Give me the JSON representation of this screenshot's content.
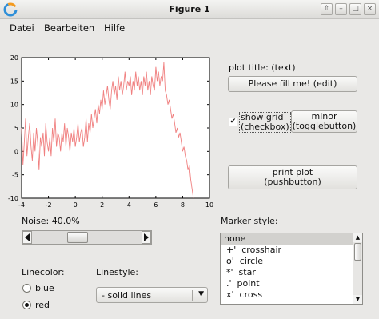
{
  "window": {
    "title": "Figure 1",
    "controls": [
      "restore-icon",
      "minimize-icon",
      "maximize-icon",
      "close-icon"
    ]
  },
  "menu": [
    {
      "label": "Datei"
    },
    {
      "label": "Bearbeiten"
    },
    {
      "label": "Hilfe"
    }
  ],
  "chart_data": {
    "type": "line",
    "color": "#f08080",
    "xlim": [
      -4,
      10
    ],
    "ylim": [
      -10,
      20
    ],
    "xticks": [
      "-4",
      "-2",
      "0",
      "2",
      "4",
      "6",
      "8",
      "10"
    ],
    "yticks": [
      "-10",
      "-5",
      "0",
      "5",
      "10",
      "15",
      "20"
    ],
    "grid": false,
    "x": [
      -4.0,
      -3.9,
      -3.8,
      -3.7,
      -3.6,
      -3.5,
      -3.4,
      -3.3,
      -3.2,
      -3.1,
      -3.0,
      -2.9,
      -2.8,
      -2.7,
      -2.6,
      -2.5,
      -2.4,
      -2.3,
      -2.2,
      -2.1,
      -2.0,
      -1.9,
      -1.8,
      -1.7,
      -1.6,
      -1.5,
      -1.4,
      -1.3,
      -1.2,
      -1.1,
      -1.0,
      -0.9,
      -0.8,
      -0.7,
      -0.6,
      -0.5,
      -0.4,
      -0.3,
      -0.2,
      -0.1,
      0.0,
      0.1,
      0.2,
      0.3,
      0.4,
      0.5,
      0.6,
      0.7,
      0.8,
      0.9,
      1.0,
      1.1,
      1.2,
      1.3,
      1.4,
      1.5,
      1.6,
      1.7,
      1.8,
      1.9,
      2.0,
      2.1,
      2.2,
      2.3,
      2.4,
      2.5,
      2.6,
      2.7,
      2.8,
      2.9,
      3.0,
      3.1,
      3.2,
      3.3,
      3.4,
      3.5,
      3.6,
      3.7,
      3.8,
      3.9,
      4.0,
      4.1,
      4.2,
      4.3,
      4.4,
      4.5,
      4.6,
      4.7,
      4.8,
      4.9,
      5.0,
      5.1,
      5.2,
      5.3,
      5.4,
      5.5,
      5.6,
      5.7,
      5.8,
      5.9,
      6.0,
      6.1,
      6.2,
      6.3,
      6.4,
      6.5,
      6.6,
      6.7,
      6.8,
      6.9,
      7.0,
      7.1,
      7.2,
      7.3,
      7.4,
      7.5,
      7.6,
      7.7,
      7.8,
      7.9,
      8.0,
      8.1,
      8.2,
      8.3,
      8.4,
      8.5,
      8.6,
      8.7,
      8.8,
      8.9,
      9.0
    ],
    "y": [
      5,
      -3,
      2,
      7,
      -1,
      3,
      6,
      1,
      -2,
      4,
      0,
      5,
      2,
      -4,
      3,
      1,
      4,
      -1,
      6,
      2,
      0,
      3,
      -1,
      5,
      2,
      7,
      1,
      4,
      3,
      0,
      4,
      2,
      6,
      1,
      5,
      3,
      0,
      4,
      2,
      5,
      1,
      3,
      6,
      2,
      4,
      5,
      1,
      3,
      7,
      2,
      6,
      4,
      8,
      5,
      7,
      9,
      6,
      10,
      8,
      11,
      9,
      13,
      10,
      12,
      14,
      11,
      9,
      13,
      15,
      12,
      14,
      11,
      16,
      13,
      15,
      12,
      14,
      17,
      13,
      15,
      14,
      16,
      12,
      15,
      13,
      17,
      14,
      16,
      13,
      15,
      12,
      16,
      14,
      17,
      13,
      15,
      12,
      16,
      14,
      13,
      18,
      15,
      17,
      14,
      16,
      15,
      19,
      13,
      12,
      10,
      11,
      9,
      7,
      8,
      6,
      4,
      5,
      3,
      4,
      2,
      0,
      1,
      -1,
      -2,
      -4,
      -3,
      -6,
      -8,
      -10
    ]
  },
  "controls": {
    "plot_title_label": "plot title: (text)",
    "plot_title_button": "Please fill me! (edit)",
    "show_grid_checked": true,
    "show_grid_label_line1": "show grid",
    "show_grid_label_line2": "(checkbox)",
    "minor_line1": "minor",
    "minor_line2": "(togglebutton)",
    "print_line1": "print plot",
    "print_line2": "(pushbutton)",
    "noise_label": "Noise: 40.0%",
    "noise_value_fraction": 0.4,
    "marker_style_label": "Marker style:",
    "linecolor_label": "Linecolor:",
    "linestyle_label": "Linestyle:",
    "color_blue": "blue",
    "color_red": "red",
    "selected_color": "red",
    "linestyle_value": "-  solid lines"
  },
  "markers": [
    "none",
    "'+'  crosshair",
    "'o'  circle",
    "'*'  star",
    "'.'  point",
    "'x'  cross"
  ],
  "selected_marker": 0
}
